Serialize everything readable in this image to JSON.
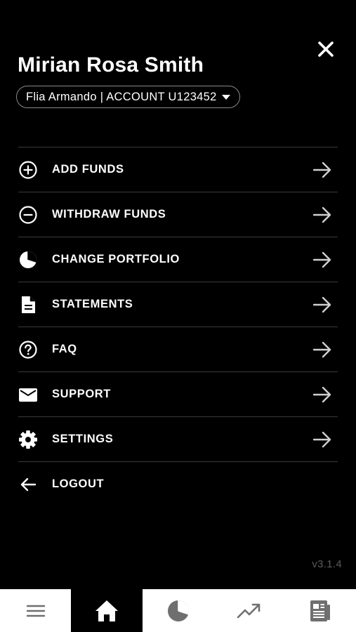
{
  "header": {
    "user_name": "Mirian Rosa Smith",
    "account_selector": "Flia Armando | ACCOUNT U123452"
  },
  "menu": {
    "items": [
      {
        "label": "ADD FUNDS",
        "icon": "plus-circle-icon"
      },
      {
        "label": "WITHDRAW FUNDS",
        "icon": "minus-circle-icon"
      },
      {
        "label": "CHANGE PORTFOLIO",
        "icon": "pie-chart-icon"
      },
      {
        "label": "STATEMENTS",
        "icon": "document-icon"
      },
      {
        "label": "FAQ",
        "icon": "help-circle-icon"
      },
      {
        "label": "SUPPORT",
        "icon": "envelope-icon"
      },
      {
        "label": "SETTINGS",
        "icon": "gear-icon"
      },
      {
        "label": "LOGOUT",
        "icon": "arrow-left-icon"
      }
    ]
  },
  "footer": {
    "version": "v3.1.4"
  },
  "tabbar": {
    "tabs": [
      {
        "icon": "menu-icon",
        "active": false
      },
      {
        "icon": "home-icon",
        "active": true
      },
      {
        "icon": "pie-chart-icon",
        "active": false
      },
      {
        "icon": "trending-up-icon",
        "active": false
      },
      {
        "icon": "newspaper-icon",
        "active": false
      }
    ]
  },
  "colors": {
    "background": "#000000",
    "divider": "#3a3a3a",
    "version_text": "#5b5b5b",
    "tabbar_bg": "#ffffff",
    "tab_icon": "#6f6f6f"
  }
}
